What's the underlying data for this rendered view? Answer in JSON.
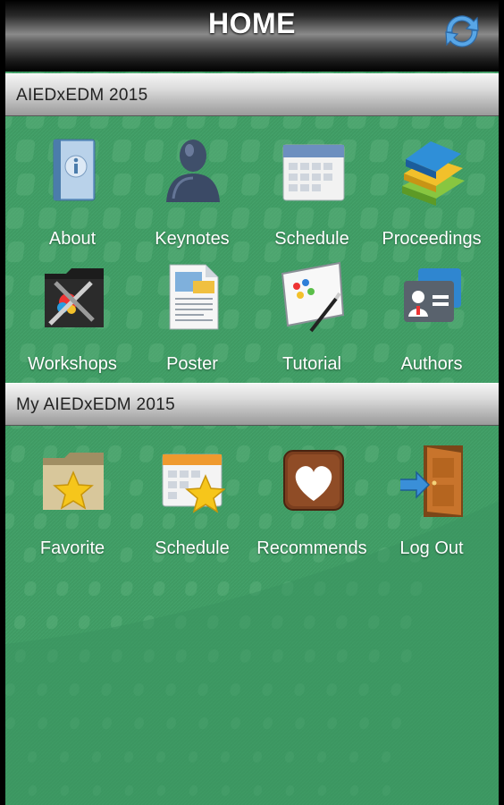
{
  "header": {
    "title": "HOME",
    "refresh_icon": "refresh-icon"
  },
  "sections": [
    {
      "title": "AIEDxEDM 2015",
      "items": [
        {
          "label": "About",
          "icon": "info-book-icon"
        },
        {
          "label": "Keynotes",
          "icon": "person-icon"
        },
        {
          "label": "Schedule",
          "icon": "calendar-icon"
        },
        {
          "label": "Proceedings",
          "icon": "books-icon"
        },
        {
          "label": "Workshops",
          "icon": "tools-folder-icon"
        },
        {
          "label": "Poster",
          "icon": "poster-document-icon"
        },
        {
          "label": "Tutorial",
          "icon": "whiteboard-icon"
        },
        {
          "label": "Authors",
          "icon": "contact-card-icon"
        }
      ]
    },
    {
      "title": "My AIEDxEDM 2015",
      "items": [
        {
          "label": "Favorite",
          "icon": "star-folder-icon"
        },
        {
          "label": "Schedule",
          "icon": "calendar-star-icon"
        },
        {
          "label": "Recommends",
          "icon": "heart-icon"
        },
        {
          "label": "Log Out",
          "icon": "door-exit-icon"
        }
      ]
    }
  ],
  "colors": {
    "background": "#3f9a63",
    "label": "#ffffff",
    "header_text": "#222222"
  }
}
